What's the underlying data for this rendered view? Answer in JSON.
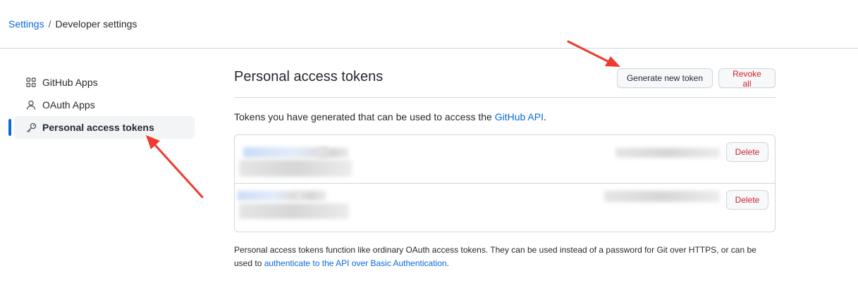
{
  "breadcrumb": {
    "root": "Settings",
    "separator": "/",
    "current": "Developer settings"
  },
  "sidebar": {
    "items": [
      {
        "label": "GitHub Apps",
        "icon": "apps-grid-icon"
      },
      {
        "label": "OAuth Apps",
        "icon": "person-icon"
      },
      {
        "label": "Personal access tokens",
        "icon": "key-icon",
        "active": true
      }
    ]
  },
  "main": {
    "title": "Personal access tokens",
    "generate_label": "Generate new token",
    "revoke_label": "Revoke all",
    "intro_text": "Tokens you have generated that can be used to access the ",
    "intro_link": "GitHub API",
    "intro_end": ".",
    "tokens": [
      {
        "delete_label": "Delete"
      },
      {
        "delete_label": "Delete"
      }
    ],
    "footer_text": "Personal access tokens function like ordinary OAuth access tokens. They can be used instead of a password for Git over HTTPS, or can be used to ",
    "footer_link": "authenticate to the API over Basic Authentication",
    "footer_end": "."
  },
  "colors": {
    "accent": "#0969da",
    "danger": "#cf222e",
    "annotation_arrow": "#f03a2e"
  }
}
